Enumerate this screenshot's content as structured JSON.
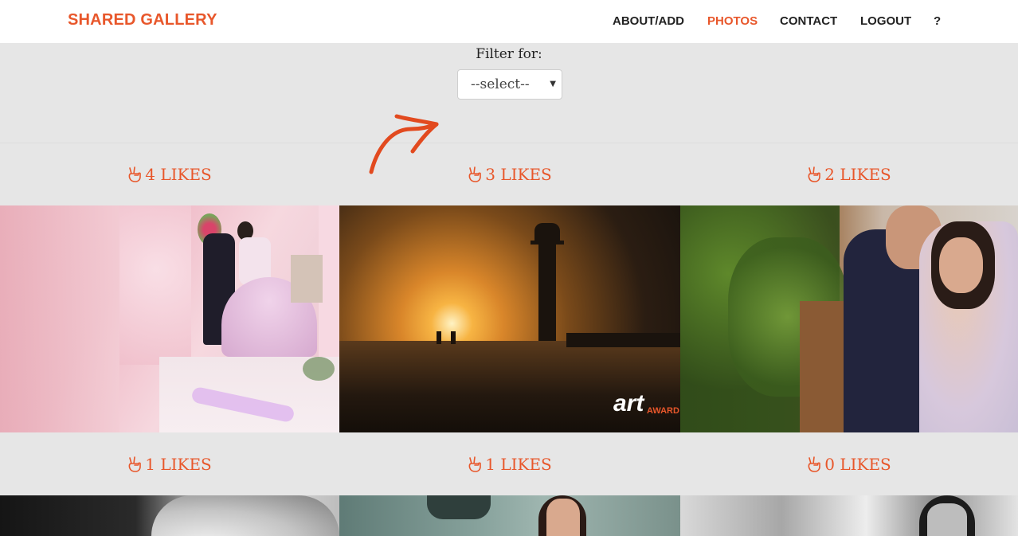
{
  "brand": "SHARED GALLERY",
  "nav": [
    {
      "label": "ABOUT/ADD",
      "active": false
    },
    {
      "label": "PHOTOS",
      "active": true
    },
    {
      "label": "CONTACT",
      "active": false
    },
    {
      "label": "LOGOUT",
      "active": false
    },
    {
      "label": "?",
      "active": false
    }
  ],
  "filter": {
    "label": "Filter for:",
    "selected": "--select--",
    "caret_icon": "caret-down-icon"
  },
  "likes": [
    {
      "text": "4 LIKES"
    },
    {
      "text": "3 LIKES"
    },
    {
      "text": "2 LIKES"
    },
    {
      "text": "1 LIKES"
    },
    {
      "text": "1 LIKES"
    },
    {
      "text": "0 LIKES"
    }
  ],
  "photos": {
    "badge_art": "art",
    "badge_award": "AWARD"
  },
  "like_icon": "peace-hand-icon",
  "colors": {
    "accent": "#e8572b",
    "background": "#e6e6e6",
    "navbar": "#ffffff"
  }
}
